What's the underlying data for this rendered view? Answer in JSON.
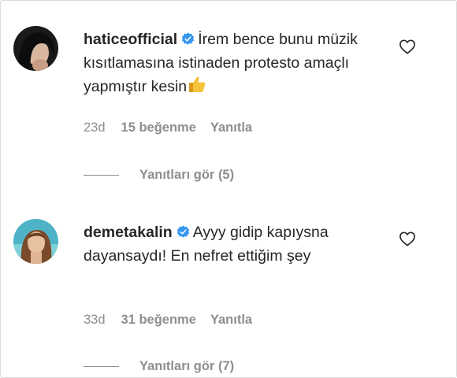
{
  "comments": [
    {
      "username": "haticeofficial",
      "text": "İrem bence bunu müzik kısıtlamasına istinaden protesto amaçlı yapmıştır kesin",
      "emoji": "thumbs-up-emoji",
      "time": "23d",
      "likes": "15 beğenme",
      "reply": "Yanıtla",
      "view_replies": "Yanıtları gör (5)"
    },
    {
      "username": "demetakalin",
      "text": "Ayyy gidip kapıysna dayansaydı! En nefret ettiğim şey",
      "time": "33d",
      "likes": "31 beğenme",
      "reply": "Yanıtla",
      "view_replies": "Yanıtları gör (7)"
    }
  ],
  "icons": {
    "verified": "verified-badge-icon",
    "heart": "heart-outline-icon"
  },
  "colors": {
    "verified_blue": "#3897f0",
    "secondary_text": "#8e8e8e",
    "primary_text": "#262626"
  }
}
